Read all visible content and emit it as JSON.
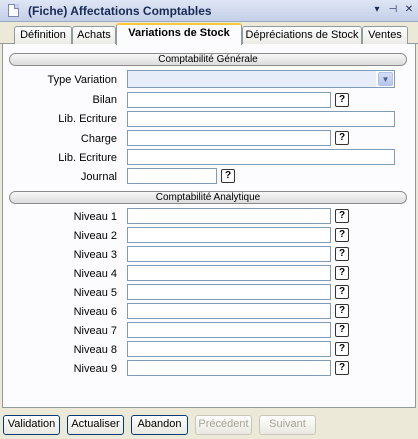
{
  "window": {
    "title": "(Fiche) Affectations Comptables",
    "pin_glyph": "▾",
    "pushpin_glyph": "⊣",
    "close_glyph": "✕"
  },
  "tabs": [
    {
      "label": "Définition",
      "active": false
    },
    {
      "label": "Achats",
      "active": false
    },
    {
      "label": "Variations de Stock",
      "active": true
    },
    {
      "label": "Dépréciations de Stock",
      "active": false
    },
    {
      "label": "Ventes",
      "active": false
    }
  ],
  "general": {
    "header": "Comptabilité Générale",
    "type_variation": {
      "label": "Type Variation",
      "value": ""
    },
    "bilan": {
      "label": "Bilan",
      "value": ""
    },
    "lib_ecriture_1": {
      "label": "Lib. Ecriture",
      "value": ""
    },
    "charge": {
      "label": "Charge",
      "value": ""
    },
    "lib_ecriture_2": {
      "label": "Lib. Ecriture",
      "value": ""
    },
    "journal": {
      "label": "Journal",
      "value": ""
    }
  },
  "analytique": {
    "header": "Comptabilité Analytique",
    "levels": [
      {
        "label": "Niveau 1",
        "value": ""
      },
      {
        "label": "Niveau 2",
        "value": ""
      },
      {
        "label": "Niveau 3",
        "value": ""
      },
      {
        "label": "Niveau 4",
        "value": ""
      },
      {
        "label": "Niveau 5",
        "value": ""
      },
      {
        "label": "Niveau 6",
        "value": ""
      },
      {
        "label": "Niveau 7",
        "value": ""
      },
      {
        "label": "Niveau 8",
        "value": ""
      },
      {
        "label": "Niveau 9",
        "value": ""
      }
    ]
  },
  "help_glyph": "?",
  "dropdown_glyph": "▼",
  "buttons": {
    "validation": "Validation",
    "actualiser": "Actualiser",
    "abandon": "Abandon",
    "precedent": "Précédent",
    "suivant": "Suivant"
  }
}
